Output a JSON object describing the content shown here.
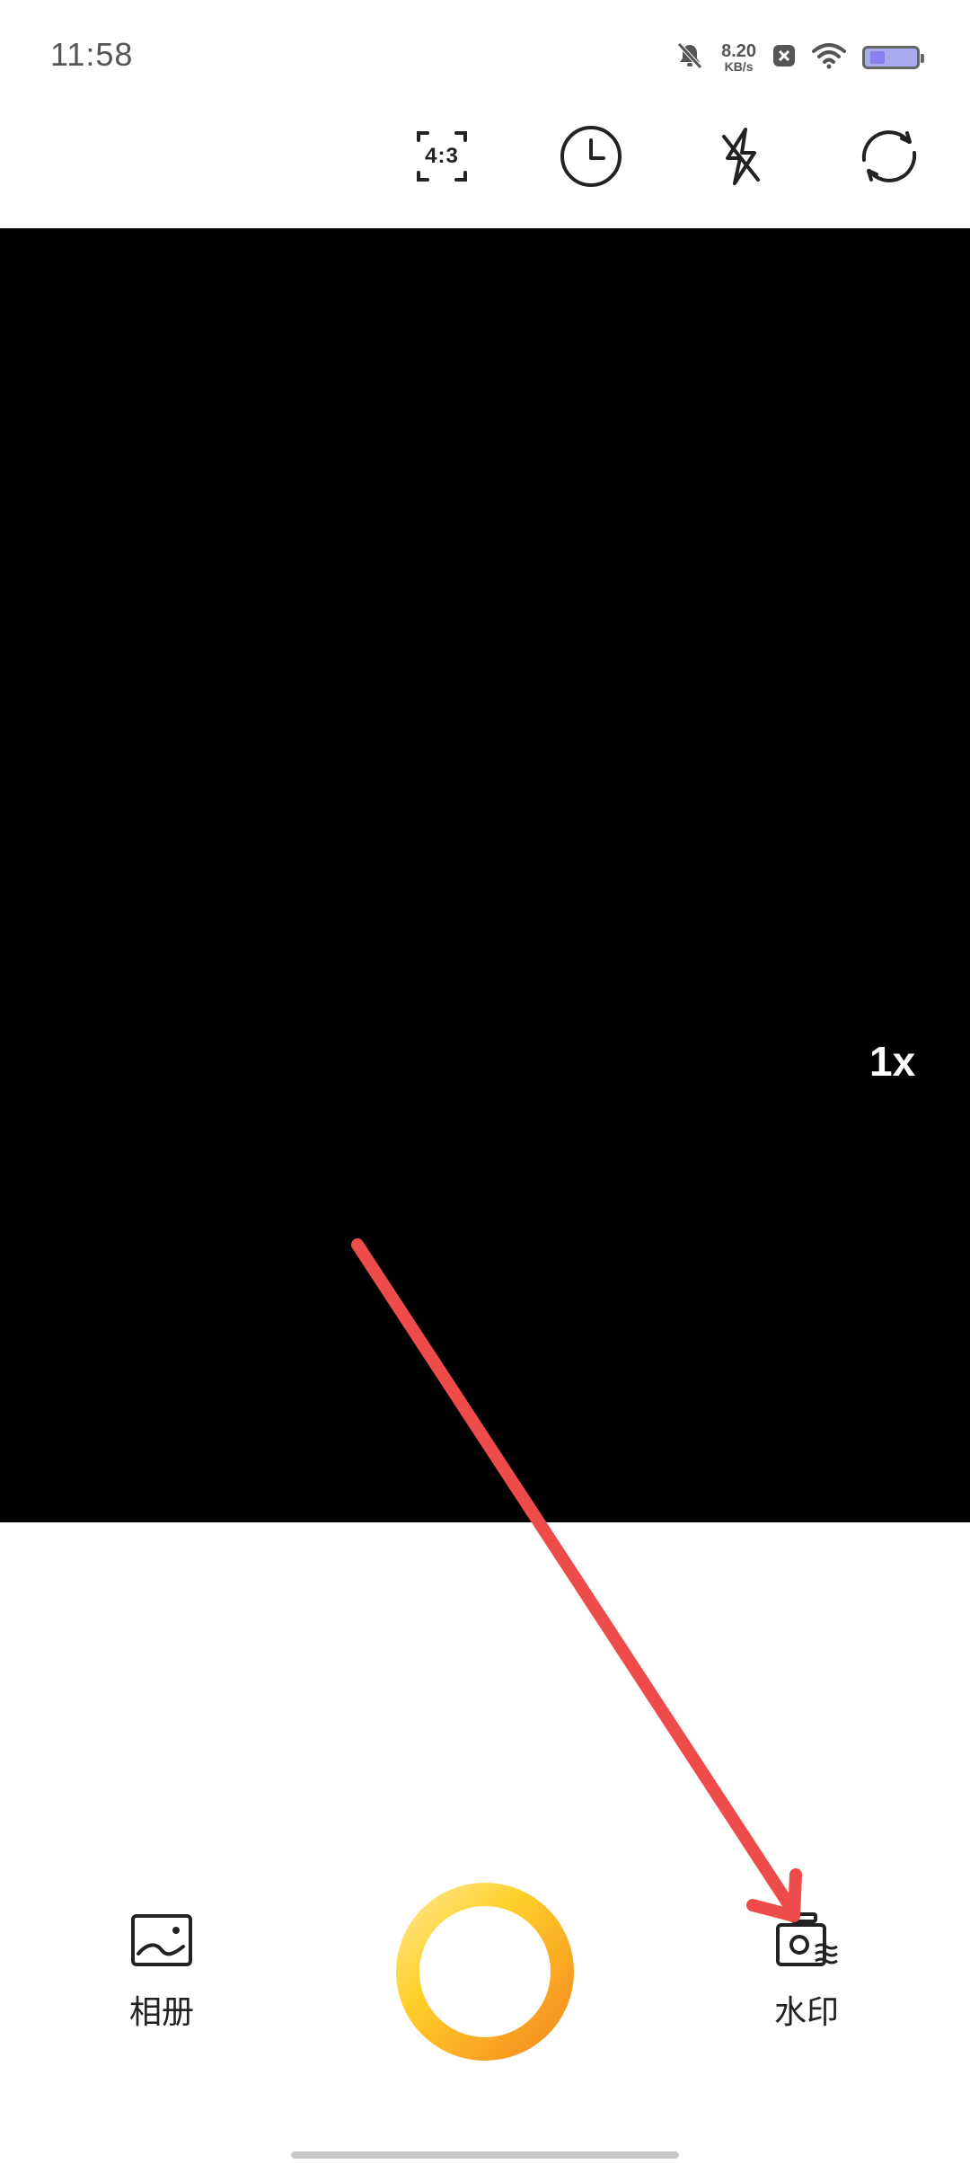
{
  "status_bar": {
    "time": "11:58",
    "net_speed_value": "8.20",
    "net_speed_unit": "KB/s",
    "icons": [
      "bell-off-icon",
      "close-badge-icon",
      "wifi-icon",
      "battery-icon"
    ]
  },
  "toolbar": {
    "aspect_ratio": "4:3",
    "icons": [
      "aspect-ratio-icon",
      "timer-icon",
      "flash-off-icon",
      "switch-camera-icon"
    ]
  },
  "viewfinder": {
    "zoom": "1x"
  },
  "bottom": {
    "album_label": "相册",
    "watermark_label": "水印"
  },
  "colors": {
    "shutter_gradient": [
      "#FFD12B",
      "#F58A1F"
    ],
    "annotation_arrow": "#EE4B4B"
  }
}
